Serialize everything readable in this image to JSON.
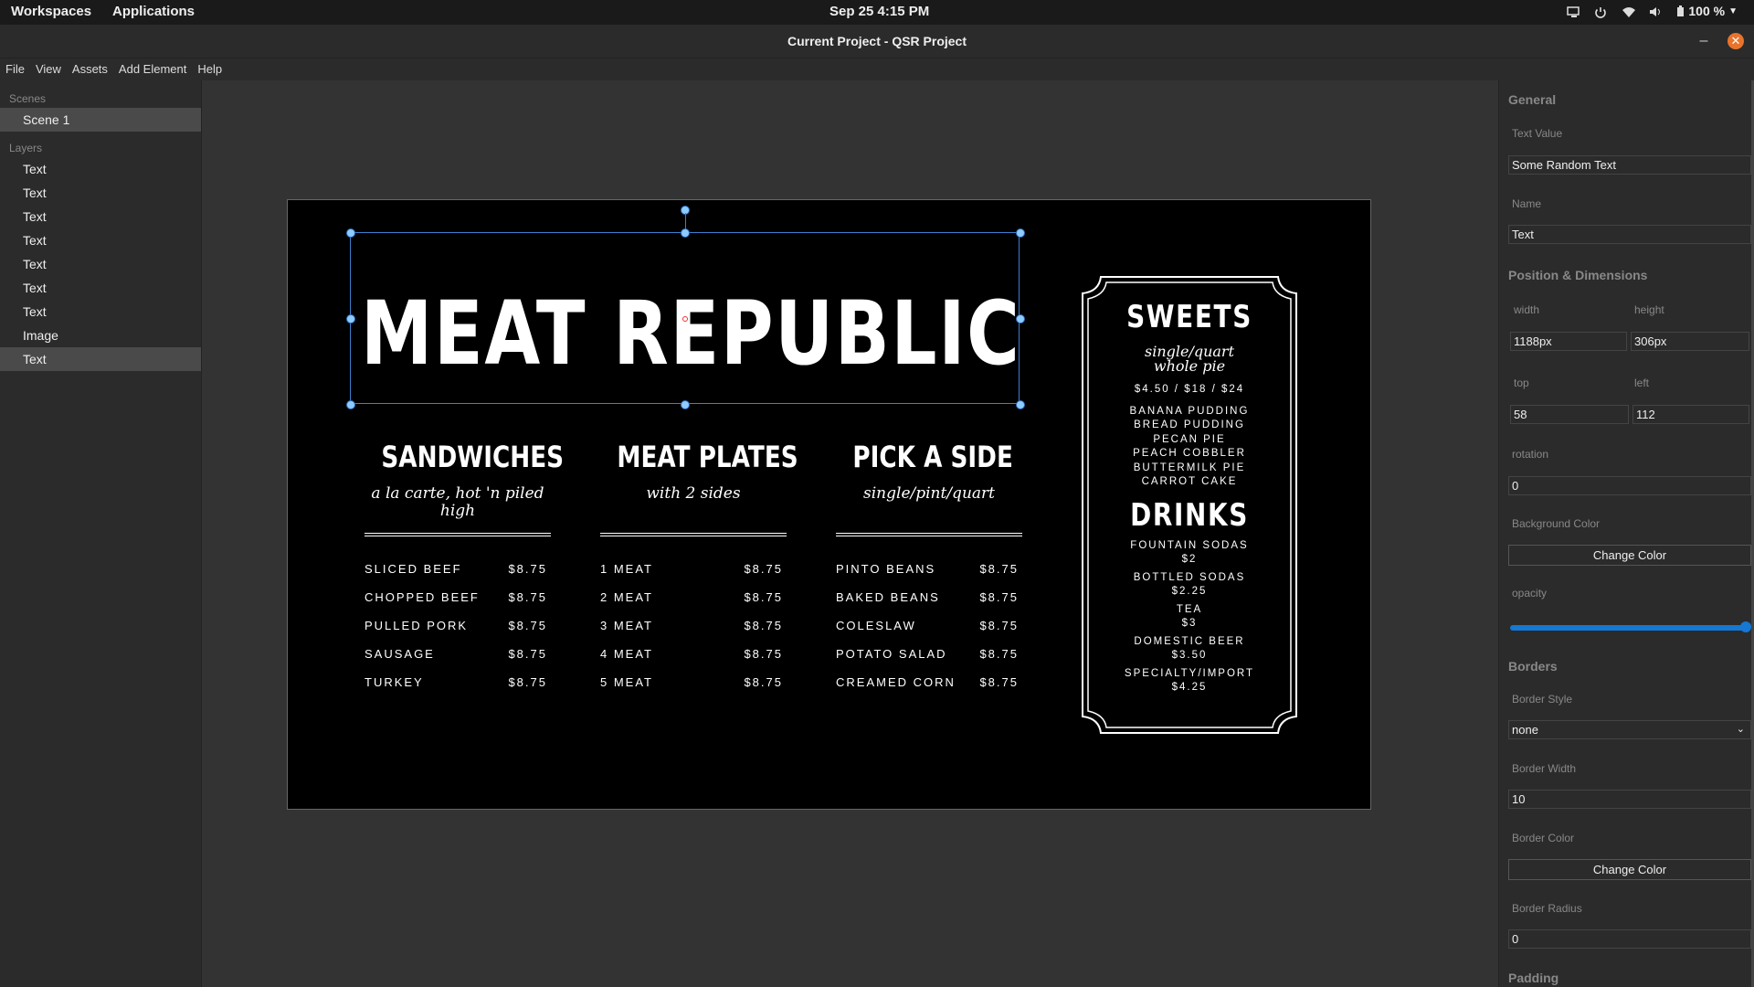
{
  "topbar": {
    "workspaces": "Workspaces",
    "applications": "Applications",
    "clock": "Sep 25   4:15 PM",
    "battery": "100 %"
  },
  "window": {
    "title": "Current Project - QSR Project",
    "close_glyph": "✕",
    "minimize_glyph": "–"
  },
  "menu": [
    "File",
    "View",
    "Assets",
    "Add Element",
    "Help"
  ],
  "left_panel": {
    "scenes_label": "Scenes",
    "scenes": [
      "Scene 1"
    ],
    "layers_label": "Layers",
    "layers": [
      "Text",
      "Text",
      "Text",
      "Text",
      "Text",
      "Text",
      "Text",
      "Image",
      "Text"
    ],
    "selected_layer_index": 8
  },
  "menu_board": {
    "title": "MEAT REPUBLIC",
    "columns": [
      {
        "heading": "SANDWICHES",
        "subtitle": "a la carte, hot 'n piled high",
        "items": [
          {
            "name": "SLICED BEEF",
            "price": "$8.75"
          },
          {
            "name": "CHOPPED BEEF",
            "price": "$8.75"
          },
          {
            "name": "PULLED PORK",
            "price": "$8.75"
          },
          {
            "name": "SAUSAGE",
            "price": "$8.75"
          },
          {
            "name": "TURKEY",
            "price": "$8.75"
          }
        ]
      },
      {
        "heading": "MEAT PLATES",
        "subtitle": "with 2 sides",
        "items": [
          {
            "name": "1 MEAT",
            "price": "$8.75"
          },
          {
            "name": "2 MEAT",
            "price": "$8.75"
          },
          {
            "name": "3 MEAT",
            "price": "$8.75"
          },
          {
            "name": "4 MEAT",
            "price": "$8.75"
          },
          {
            "name": "5 MEAT",
            "price": "$8.75"
          }
        ]
      },
      {
        "heading": "PICK A SIDE",
        "subtitle": "single/pint/quart",
        "items": [
          {
            "name": "PINTO BEANS",
            "price": "$8.75"
          },
          {
            "name": "BAKED BEANS",
            "price": "$8.75"
          },
          {
            "name": "COLESLAW",
            "price": "$8.75"
          },
          {
            "name": "POTATO SALAD",
            "price": "$8.75"
          },
          {
            "name": "CREAMED CORN",
            "price": "$8.75"
          }
        ]
      }
    ],
    "sweets": {
      "heading": "SWEETS",
      "subtitle_1": "single/quart",
      "subtitle_2": "whole pie",
      "prices": "$4.50 / $18 / $24",
      "items": [
        "BANANA PUDDING",
        "BREAD PUDDING",
        "PECAN PIE",
        "PEACH COBBLER",
        "BUTTERMILK PIE",
        "CARROT CAKE"
      ]
    },
    "drinks": {
      "heading": "DRINKS",
      "items": [
        {
          "name": "FOUNTAIN SODAS",
          "price": "$2"
        },
        {
          "name": "BOTTLED SODAS",
          "price": "$2.25"
        },
        {
          "name": "TEA",
          "price": "$3"
        },
        {
          "name": "DOMESTIC BEER",
          "price": "$3.50"
        },
        {
          "name": "SPECIALTY/IMPORT",
          "price": "$4.25"
        }
      ]
    }
  },
  "properties": {
    "general_label": "General",
    "text_value_label": "Text Value",
    "text_value": "Some Random Text",
    "name_label": "Name",
    "name_value": "Text",
    "position_label": "Position & Dimensions",
    "width_label": "width",
    "width_value": "1188px",
    "height_label": "height",
    "height_value": "306px",
    "top_label": "top",
    "top_value": "58",
    "left_label": "left",
    "left_value": "112",
    "rotation_label": "rotation",
    "rotation_value": "0",
    "background_color_label": "Background Color",
    "change_color_label": "Change Color",
    "opacity_label": "opacity",
    "opacity_value": 1.0,
    "borders_label": "Borders",
    "border_style_label": "Border Style",
    "border_style_value": "none",
    "border_width_label": "Border Width",
    "border_width_value": "10",
    "border_color_label": "Border Color",
    "border_radius_label": "Border Radius",
    "border_radius_value": "0",
    "padding_label": "Padding"
  },
  "colors": {
    "accent_blue": "#1478d4",
    "close_orange": "#e8742c",
    "selection_blue": "#3d7fd0"
  }
}
